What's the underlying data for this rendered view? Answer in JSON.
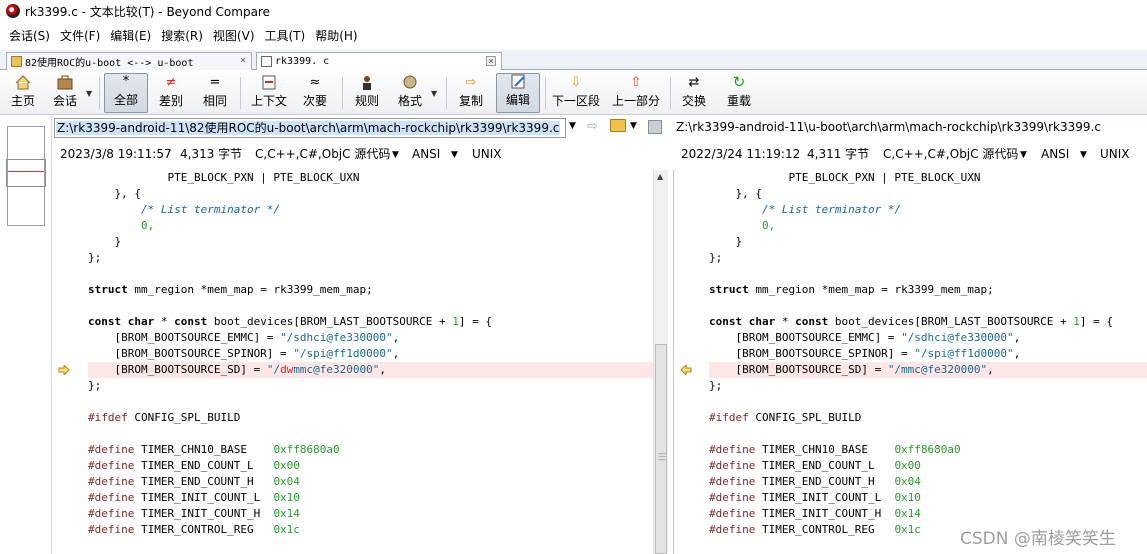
{
  "window": {
    "title": "rk3399.c - 文本比较(T) - Beyond Compare"
  },
  "menu": [
    "会话(S)",
    "文件(F)",
    "编辑(E)",
    "搜索(R)",
    "视图(V)",
    "工具(T)",
    "帮助(H)"
  ],
  "tabs": [
    {
      "label": "82使用ROC的u-boot <--> u-boot",
      "close": "×"
    },
    {
      "label": "rk3399. c",
      "close": "×"
    }
  ],
  "toolbar": {
    "home": "主页",
    "session": "会话",
    "all": "全部",
    "diffs": "差别",
    "same": "相同",
    "context": "上下文",
    "minor": "次要",
    "rules": "规则",
    "format": "格式",
    "copy": "复制",
    "edit": "编辑",
    "next_section": "下一区段",
    "prev_part": "上一部分",
    "swap": "交换",
    "reload": "重载"
  },
  "left": {
    "path": "Z:\\rk3399-android-11\\82使用ROC的u-boot\\arch\\arm\\mach-rockchip\\rk3399\\rk3399.c",
    "date": "2023/3/8 19:11:57",
    "size": "4,313 字节",
    "lang": "C,C++,C#,ObjC 源代码",
    "enc": "ANSI",
    "eol": "UNIX"
  },
  "right": {
    "path": "Z:\\rk3399-android-11\\u-boot\\arch\\arm\\mach-rockchip\\rk3399\\rk3399.c",
    "date": "2022/3/24 11:19:12",
    "size": "4,311 字节",
    "lang": "C,C++,C#,ObjC 源代码",
    "enc": "ANSI",
    "eol": "UNIX"
  },
  "code": {
    "l0": "            PTE_BLOCK_PXN | PTE_BLOCK_UXN",
    "l1": "    }, {",
    "l2": "        /* List terminator */",
    "l3": "        0,",
    "l4": "    }",
    "l5": "};",
    "l7a": "struct",
    "l7b": " mm_region *mem_map = rk3399_mem_map;",
    "l9a": "const char",
    "l9b": " * ",
    "l9c": "const",
    "l9d": " boot_devices[BROM_LAST_BOOTSOURCE + ",
    "l9e": "1",
    "l9f": "] = {",
    "l10a": "    [BROM_BOOTSOURCE_EMMC] = ",
    "l10b": "\"/sdhci@fe330000\"",
    "l10c": ",",
    "l11a": "    [BROM_BOOTSOURCE_SPINOR] = ",
    "l11b": "\"/spi@ff1d0000\"",
    "l11c": ",",
    "l12a": "    [BROM_BOOTSOURCE_SD] = ",
    "l12b": "\"/",
    "l12c": "dw",
    "l12d": "mmc@fe320000\"",
    "l12e": ",",
    "r12b": "\"/mmc@fe320000\"",
    "l13": "};",
    "l15a": "#ifdef",
    "l15b": " CONFIG_SPL_BUILD",
    "d1a": "#define",
    "d1b": " TIMER_CHN10_BASE    ",
    "d1c": "0xff8680a0",
    "d2a": "#define",
    "d2b": " TIMER_END_COUNT_L   ",
    "d2c": "0x00",
    "d3a": "#define",
    "d3b": " TIMER_END_COUNT_H   ",
    "d3c": "0x04",
    "d4a": "#define",
    "d4b": " TIMER_INIT_COUNT_L  ",
    "d4c": "0x10",
    "d5a": "#define",
    "d5b": " TIMER_INIT_COUNT_H  ",
    "d5c": "0x14",
    "d6a": "#define",
    "d6b": " TIMER_CONTROL_REG   ",
    "d6c": "0x1c"
  },
  "watermark": "CSDN @南棱笑笑生"
}
